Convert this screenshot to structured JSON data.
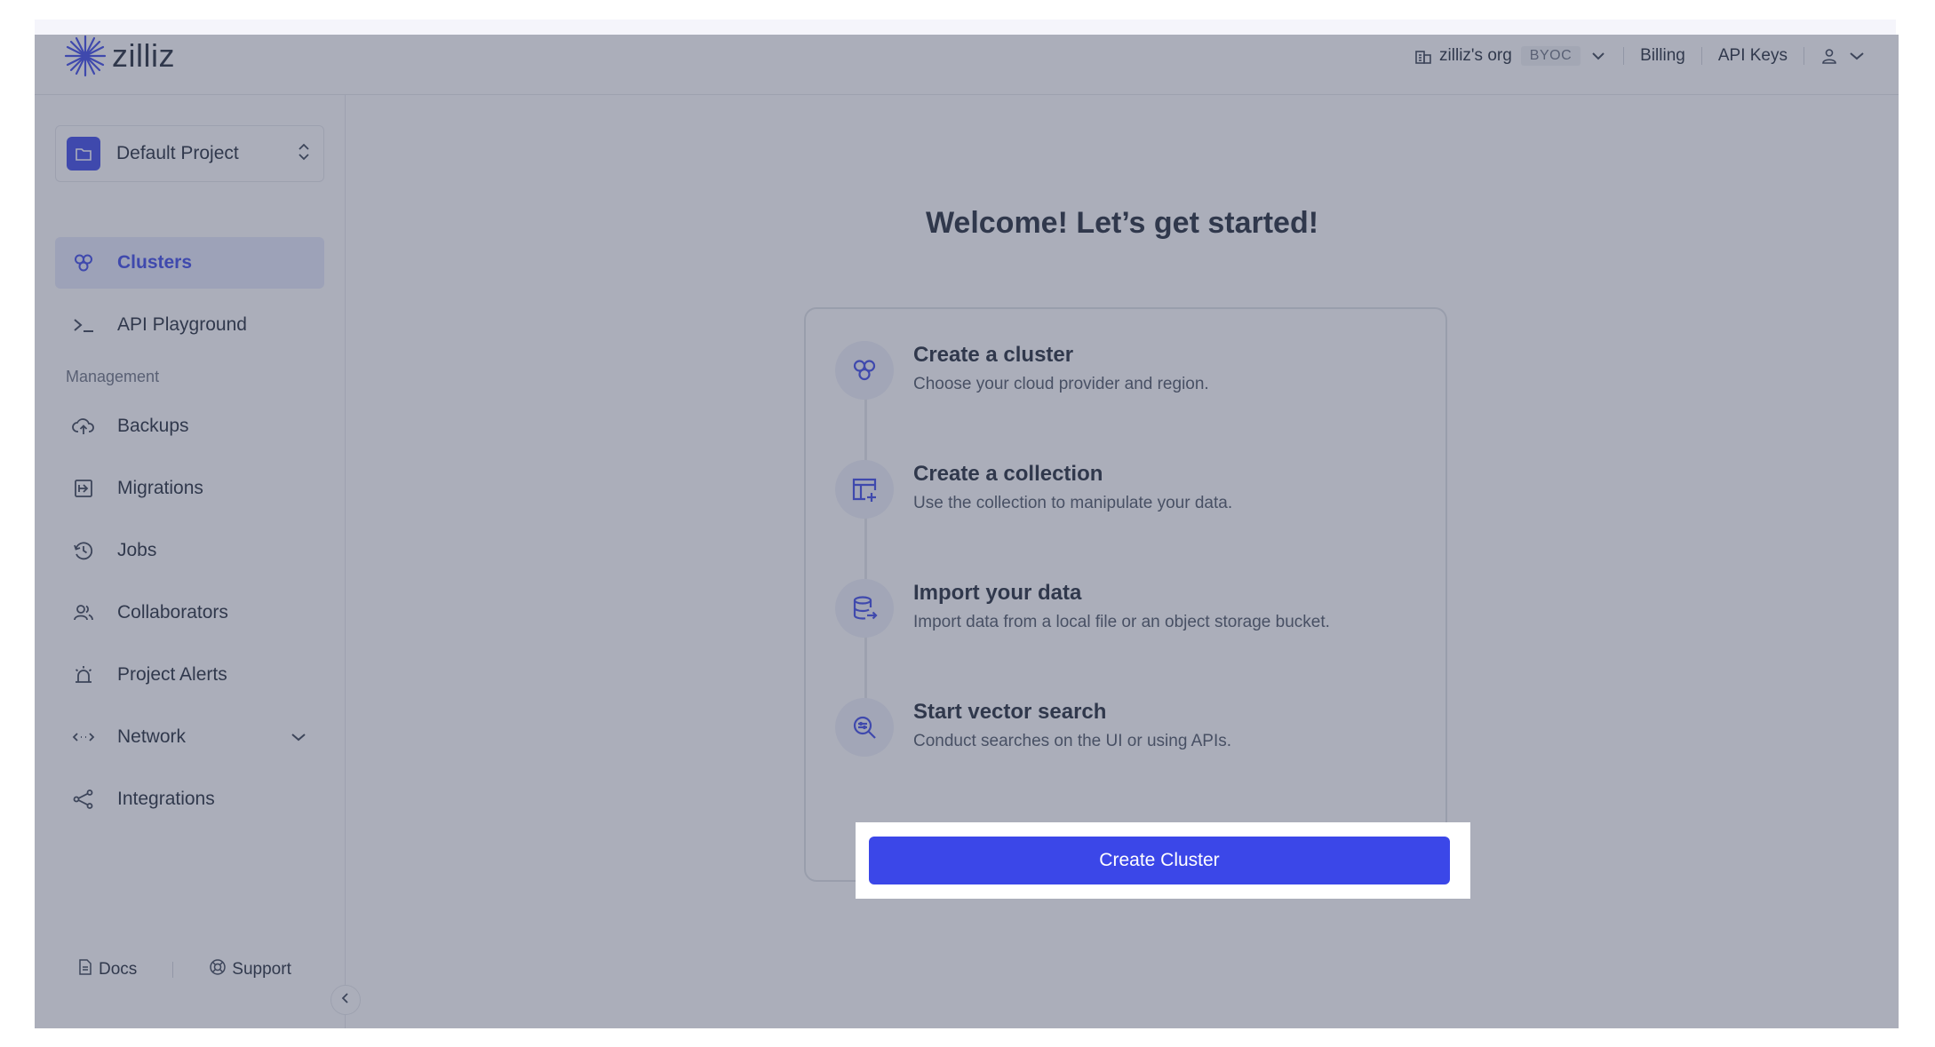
{
  "brand": {
    "name": "zilliz"
  },
  "header": {
    "org_name": "zilliz's org",
    "org_badge": "BYOC",
    "billing_label": "Billing",
    "api_keys_label": "API Keys"
  },
  "sidebar": {
    "project_name": "Default Project",
    "nav_top": [
      {
        "label": "Clusters",
        "icon": "clusters-icon",
        "active": true
      },
      {
        "label": "API Playground",
        "icon": "terminal-icon"
      }
    ],
    "management_label": "Management",
    "nav_management": [
      {
        "label": "Backups",
        "icon": "cloud-upload-icon"
      },
      {
        "label": "Migrations",
        "icon": "migration-icon"
      },
      {
        "label": "Jobs",
        "icon": "history-icon"
      },
      {
        "label": "Collaborators",
        "icon": "users-icon"
      },
      {
        "label": "Project Alerts",
        "icon": "alarm-icon"
      },
      {
        "label": "Network",
        "icon": "network-icon"
      },
      {
        "label": "Integrations",
        "icon": "share-icon"
      }
    ],
    "footer": {
      "docs_label": "Docs",
      "support_label": "Support"
    }
  },
  "main": {
    "welcome_title": "Welcome! Let’s get started!",
    "steps": [
      {
        "title": "Create a cluster",
        "description": "Choose your cloud provider and region.",
        "icon": "clusters-icon"
      },
      {
        "title": "Create a collection",
        "description": "Use the collection to manipulate your data.",
        "icon": "table-add-icon"
      },
      {
        "title": "Import your data",
        "description": "Import data from a local file or an object storage bucket.",
        "icon": "database-import-icon"
      },
      {
        "title": "Start vector search",
        "description": "Conduct searches on the UI or using APIs.",
        "icon": "vector-search-icon"
      }
    ],
    "create_button_label": "Create Cluster"
  },
  "colors": {
    "accent": "#3b47e8",
    "overlay": "#444b66"
  }
}
